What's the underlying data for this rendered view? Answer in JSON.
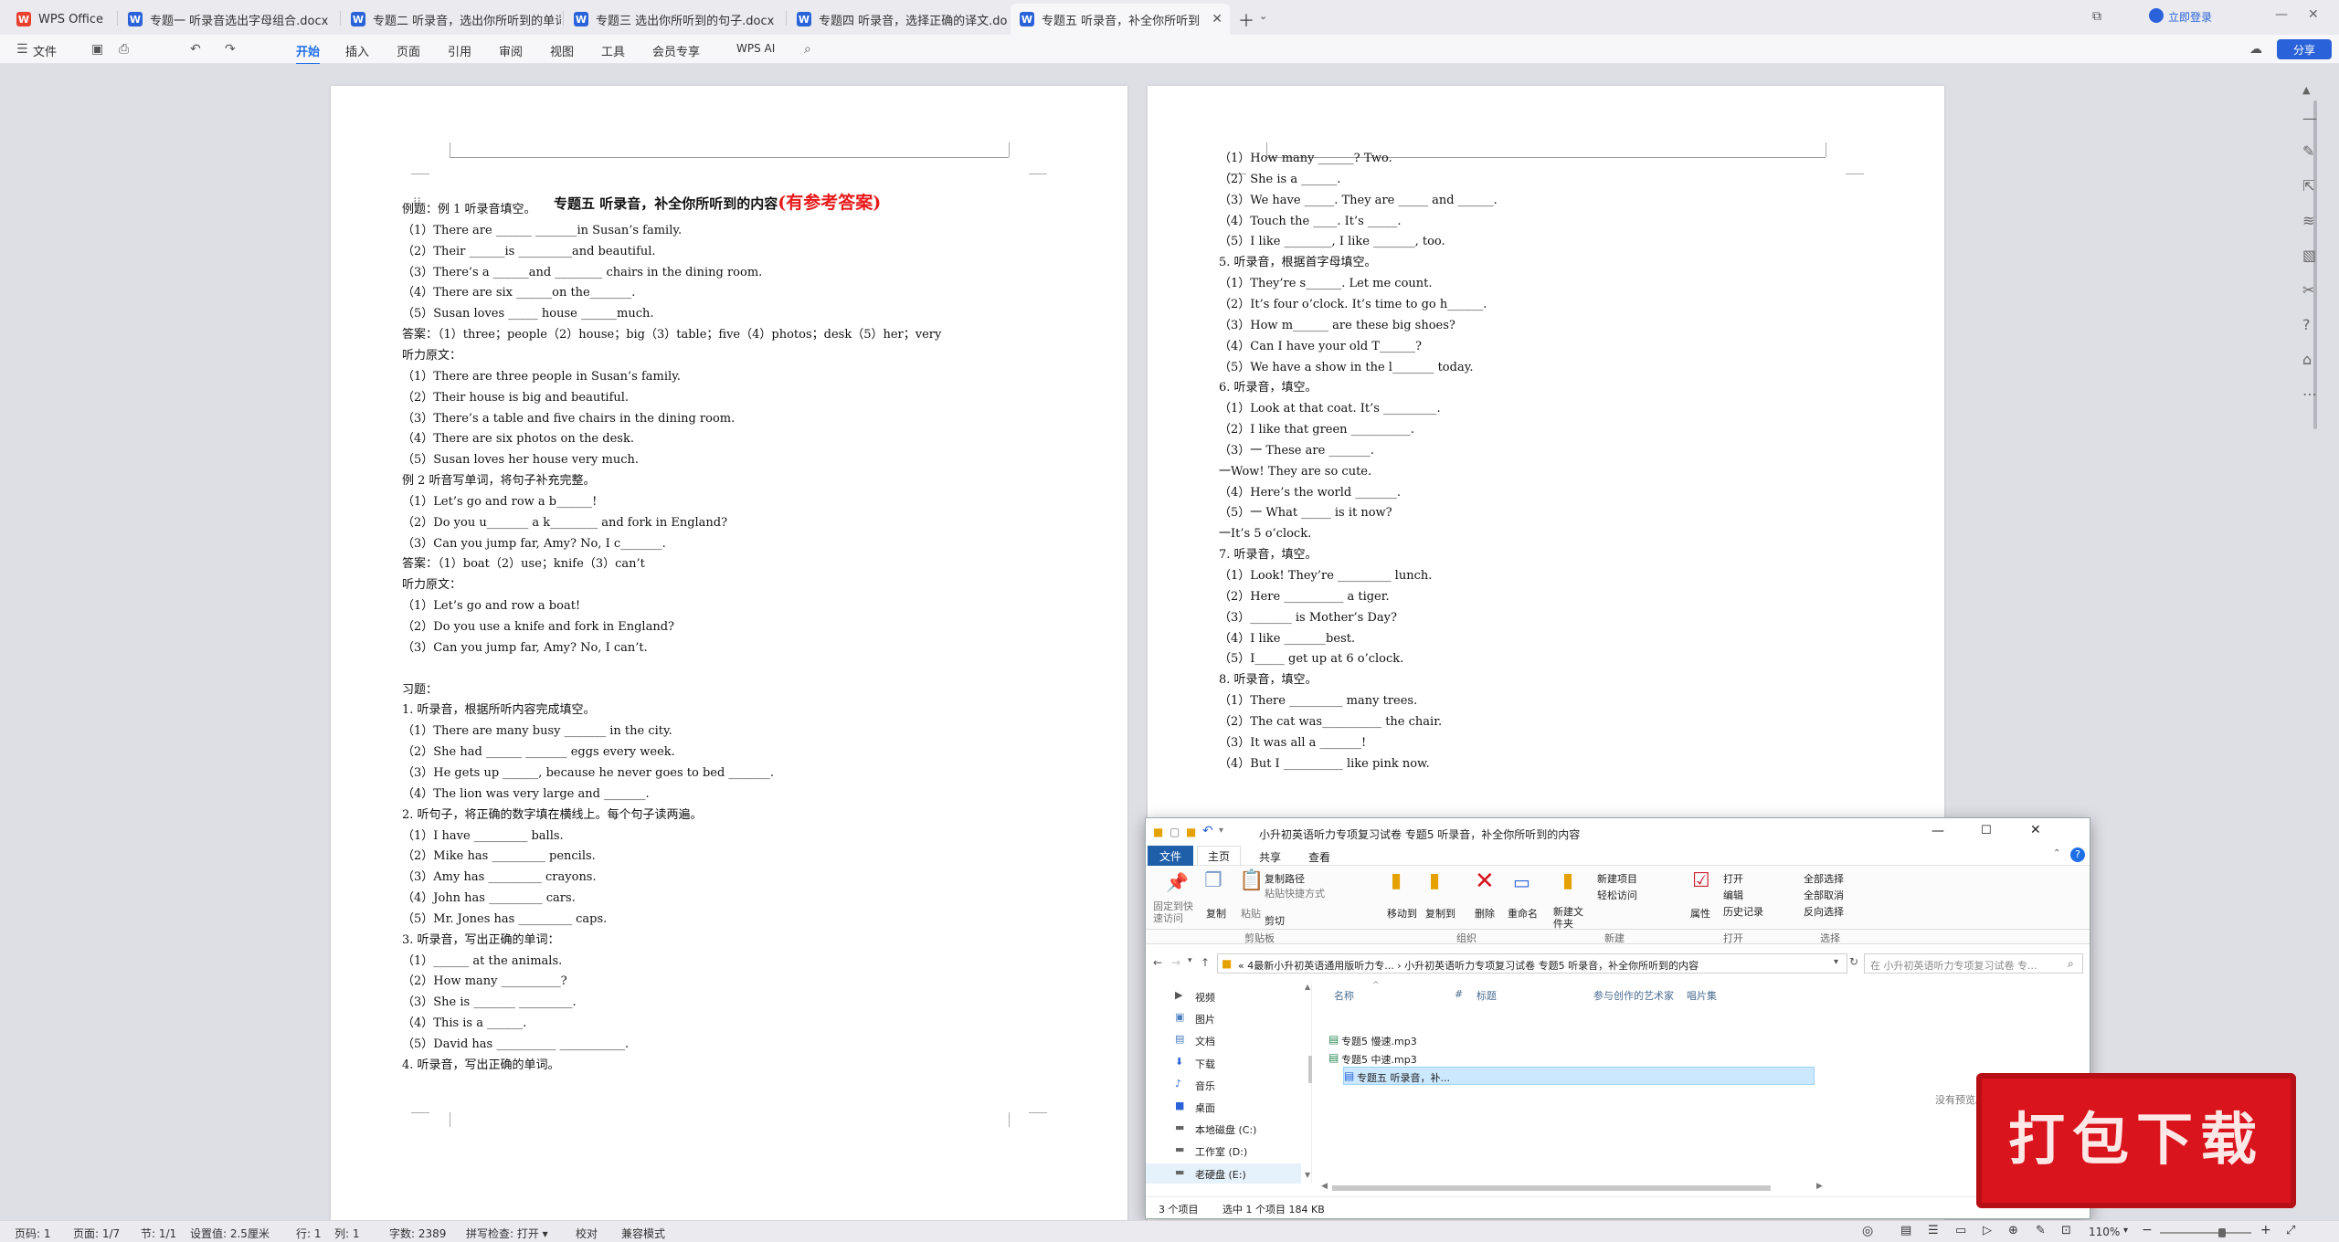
{
  "tabs": [
    {
      "label": "WPS Office",
      "icon": "W",
      "color": "#e8412e"
    },
    {
      "label": "专题一 听录音选出字母组合.docx",
      "icon": "W",
      "color": "#2a63d9"
    },
    {
      "label": "专题二 听录音，选出你所听到的单词",
      "icon": "W",
      "color": "#2a63d9"
    },
    {
      "label": "专题三 选出你所听到的句子.docx",
      "icon": "W",
      "color": "#2a63d9"
    },
    {
      "label": "专题四 听录音，选择正确的译文.doc",
      "icon": "W",
      "color": "#2a63d9"
    },
    {
      "label": "专题五 听录音，补全你所听到",
      "icon": "W",
      "color": "#2a63d9"
    }
  ],
  "titlebar": {
    "login": "立即登录",
    "share": "分享"
  },
  "ribbon": {
    "file": "文件",
    "menus": [
      "开始",
      "插入",
      "页面",
      "引用",
      "审阅",
      "视图",
      "工具",
      "会员专享"
    ],
    "ai": "WPS AI"
  },
  "page1": {
    "title": "专题五  听录音，补全你所听到的内容",
    "title_red": "(有参考答案)",
    "lines": [
      "例题：例 1  听录音填空。",
      "（1）There are ______ _______in Susan’s family.",
      "（2）Their ______is _________and beautiful.",
      "（3）There’s a ______and ________ chairs in the dining room.",
      "（4）There are six ______on the_______.",
      "（5）Susan loves _____ house ______much.",
      "答案：（1）three；people（2）house；big（3）table；five（4）photos；desk（5）her；very",
      "听力原文：",
      "（1）There are three people in Susan’s family.",
      "（2）Their house is big and beautiful.",
      "（3）There’s a table and five chairs in the dining room.",
      "（4）There are six photos on the desk.",
      "（5）Susan loves her house very much.",
      "例 2  听音写单词，将句子补充完整。",
      "（1）Let’s go and row a b______!",
      "（2）Do you u_______ a k________ and fork in England?",
      "（3）Can you jump far, Amy? No, I c_______.",
      "答案：（1）boat（2）use；knife（3）can’t",
      "听力原文：",
      "（1）Let’s go and row a boat!",
      "（2）Do you use a knife and fork in England?",
      "（3）Can you jump far, Amy? No, I can’t.",
      "",
      "习题：",
      "1.  听录音，根据所听内容完成填空。",
      "（1）There are many busy _______ in the city.",
      "（2）She had ______ _______ eggs every week.",
      "（3）He gets up ______, because he never goes to bed _______.",
      "（4）The lion was very large and _______.",
      "2.  听句子，将正确的数字填在横线上。每个句子读两遍。",
      "（1）I have _________ balls.",
      "（2）Mike has _________ pencils.",
      "（3）Amy has _________ crayons.",
      "（4）John has _________ cars.",
      "（5）Mr. Jones has _________ caps.",
      "3.  听录音，写出正确的单词：",
      "（1）______ at the animals.",
      "（2）How many __________?",
      "（3）She is _______ _________.",
      "（4）This is a ______.",
      "（5）David has __________ ___________.",
      "4.  听录音，写出正确的单词。"
    ]
  },
  "page2": {
    "lines": [
      "（1）How many ______? Two.",
      "（2）She is a ______.",
      "（3）We have _____. They are _____ and ______.",
      "（4）Touch the ____. It’s _____.",
      "（5）I like ________, I like _______, too.",
      "5.  听录音，根据首字母填空。",
      "（1）They’re s______. Let me count.",
      "（2）It’s four o’clock. It’s time to go h______.",
      "（3）How m______ are these big shoes?",
      "（4）Can I have your old T______?",
      "（5）We have a show in the l_______ today.",
      "6.  听录音，填空。",
      "（1）Look at that coat. It’s _________.",
      "（2）I like that green __________.",
      "（3）一 These are _______.",
      "一Wow! They are so cute.",
      "（4）Here’s the world _______.",
      "（5）一 What _____ is it now?",
      "一It’s 5 o’clock.",
      "7.  听录音，填空。",
      "（1）Look! They’re _________ lunch.",
      "（2）Here __________ a tiger.",
      "（3）_______ is Mother’s Day?",
      "（4）I like _______best.",
      "（5）I_____ get up at 6 o’clock.",
      "8.  听录音，填空。",
      "（1）There _________ many trees.",
      "（2）The cat was__________ the chair.",
      "（3）It was all a _______!",
      "（4）But I __________ like pink now."
    ]
  },
  "explorer": {
    "title": "小升初英语听力专项复习试卷 专题5 听录音，补全你所听到的内容",
    "tabs": [
      "文件",
      "主页",
      "共享",
      "查看"
    ],
    "ribbon": {
      "pin": "固定到快速访问",
      "copy": "复制",
      "paste": "粘贴",
      "copy_path": "复制路径",
      "paste_shortcut": "粘贴快捷方式",
      "cut": "剪切",
      "move_to": "移动到",
      "copy_to": "复制到",
      "delete": "删除",
      "rename": "重命名",
      "new_folder": "新建文件夹",
      "new_item": "新建项目",
      "easy_access": "轻松访问",
      "properties": "属性",
      "open": "打开",
      "edit": "编辑",
      "history": "历史记录",
      "select_all": "全部选择",
      "select_none": "全部取消",
      "invert": "反向选择"
    },
    "groups": [
      "剪贴板",
      "组织",
      "新建",
      "打开",
      "选择"
    ],
    "address": "«  4最新小升初英语通用版听力专...  ›  小升初英语听力专项复习试卷 专题5 听录音，补全你所听到的内容",
    "search_placeholder": "在 小升初英语听力专项复习试卷 专...",
    "nav": [
      "视频",
      "图片",
      "文档",
      "下载",
      "音乐",
      "桌面",
      "本地磁盘 (C:)",
      "工作室 (D:)",
      "老硬盘 (E:)"
    ],
    "columns": [
      "名称",
      "#",
      "标题",
      "参与创作的艺术家",
      "唱片集"
    ],
    "files": [
      "专题5 慢速.mp3",
      "专题5 中速.mp3",
      "专题五 听录音，补..."
    ],
    "no_preview": "没有预览。",
    "status": {
      "count": "3 个项目",
      "selected": "选中 1 个项目  184 KB"
    }
  },
  "status": {
    "page_no": "页码: 1",
    "pages": "页面: 1/7",
    "section": "节: 1/1",
    "setting": "设置值: 2.5厘米",
    "row": "行: 1",
    "col": "列: 1",
    "words": "字数: 2389",
    "spell": "拼写检查: 打开 ▾",
    "proof": "校对",
    "compat": "兼容模式",
    "zoom": "110%"
  },
  "stamp": {
    "text": "打包下载"
  }
}
